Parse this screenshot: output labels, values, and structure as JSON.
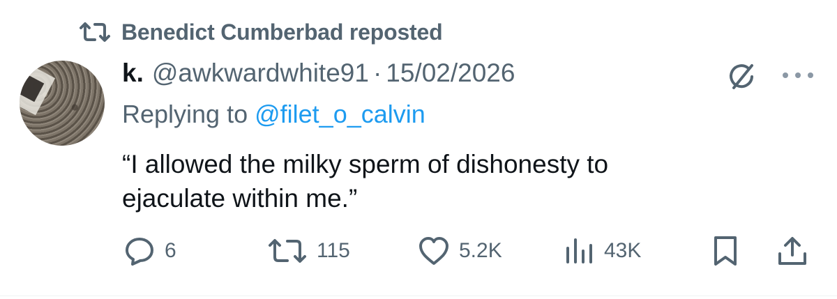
{
  "repost": {
    "text": "Benedict Cumberbad reposted",
    "icon": "repost-icon"
  },
  "tweet": {
    "author_name": "k.",
    "handle": "@awkwardwhite91",
    "separator": "·",
    "date": "15/02/2026",
    "replying_prefix": "Replying to ",
    "replying_to": "@filet_o_calvin",
    "text_lines": [
      "“I allowed the milky sperm of dishonesty to",
      "ejaculate within me.”"
    ]
  },
  "actions": {
    "replies": "6",
    "reposts": "115",
    "likes": "5.2K",
    "views": "43K"
  },
  "colors": {
    "text": "#0f1419",
    "secondary": "#536471",
    "link": "#1d9bf0",
    "divider": "#eff3f4"
  }
}
